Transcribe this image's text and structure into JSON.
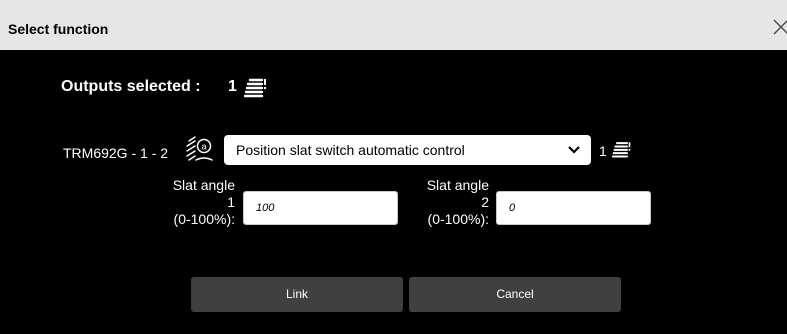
{
  "dialog": {
    "title": "Select function",
    "close_icon": "close-icon"
  },
  "outputs": {
    "label": "Outputs selected :",
    "count": "1",
    "icon": "stack-layers-icon"
  },
  "device": {
    "label": "TRM692G - 1 - 2",
    "function_icon": "slat-auto-icon",
    "function_select": "Position slat switch automatic control",
    "count": "1",
    "count_icon": "stack-layers-icon"
  },
  "params": [
    {
      "line1": "Slat angle",
      "line2": "1",
      "line3": "(0-100%):",
      "value": "100"
    },
    {
      "line1": "Slat angle",
      "line2": "2",
      "line3": "(0-100%):",
      "value": "0"
    }
  ],
  "buttons": {
    "link": "Link",
    "cancel": "Cancel"
  },
  "colors": {
    "titlebar": "#e6e6e6",
    "background": "#000000",
    "button": "#404040"
  }
}
